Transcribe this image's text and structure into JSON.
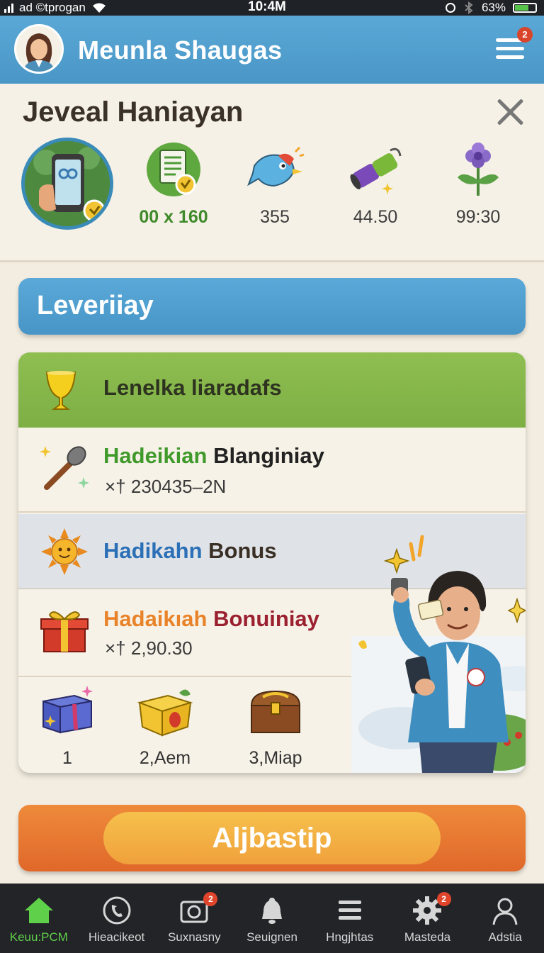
{
  "status_bar": {
    "carrier": "ad ©tprogan",
    "time": "10:4M",
    "battery": "63%"
  },
  "header": {
    "title": "Meunla Shaugas",
    "menu_badge": "2"
  },
  "profile": {
    "name": "Jeveal Haniayan",
    "stats": [
      {
        "icon": "checklist-icon",
        "value": "00 x 160"
      },
      {
        "icon": "bird-icon",
        "value": "355"
      },
      {
        "icon": "battery-tube-icon",
        "value": "44.50"
      },
      {
        "icon": "flower-icon",
        "value": "99:30"
      }
    ]
  },
  "section": {
    "title": "Leveriiay"
  },
  "rewards": {
    "header": "Lenelka liaradafs",
    "rows": [
      {
        "title_a": "Hadeikian",
        "title_b": "Blanginiay",
        "sub": "×† 230435–2N"
      },
      {
        "title_a": "Hadikahn",
        "title_b": "Bonus"
      },
      {
        "title_a": "Hadaikıah",
        "title_b": "Bonuiniay",
        "sub": "×† 2,90.30"
      }
    ],
    "prizes": [
      {
        "icon": "gift-box-icon",
        "label": "1"
      },
      {
        "icon": "yellow-gift-icon",
        "label": "2,Aem"
      },
      {
        "icon": "treasure-chest-icon",
        "label": "3,Miap"
      }
    ]
  },
  "cta": {
    "label": "Aljbastip"
  },
  "nav": {
    "items": [
      {
        "label": "Keuu:PCM",
        "icon": "home-icon",
        "active": true
      },
      {
        "label": "Hieacikeot",
        "icon": "phone-icon"
      },
      {
        "label": "Suxnasny",
        "icon": "camera-icon",
        "badge": "2"
      },
      {
        "label": "Seuignen",
        "icon": "bell-icon"
      },
      {
        "label": "Hngjhtas",
        "icon": "list-icon"
      },
      {
        "label": "Masteda",
        "icon": "gear-icon",
        "badge": "2"
      },
      {
        "label": "Adstia",
        "icon": "user-icon"
      }
    ]
  },
  "colors": {
    "header": "#4a97c7",
    "accent_green": "#7daf45",
    "cta": "#e0682a",
    "nav_bg": "#222427",
    "nav_active": "#5fd04a"
  }
}
